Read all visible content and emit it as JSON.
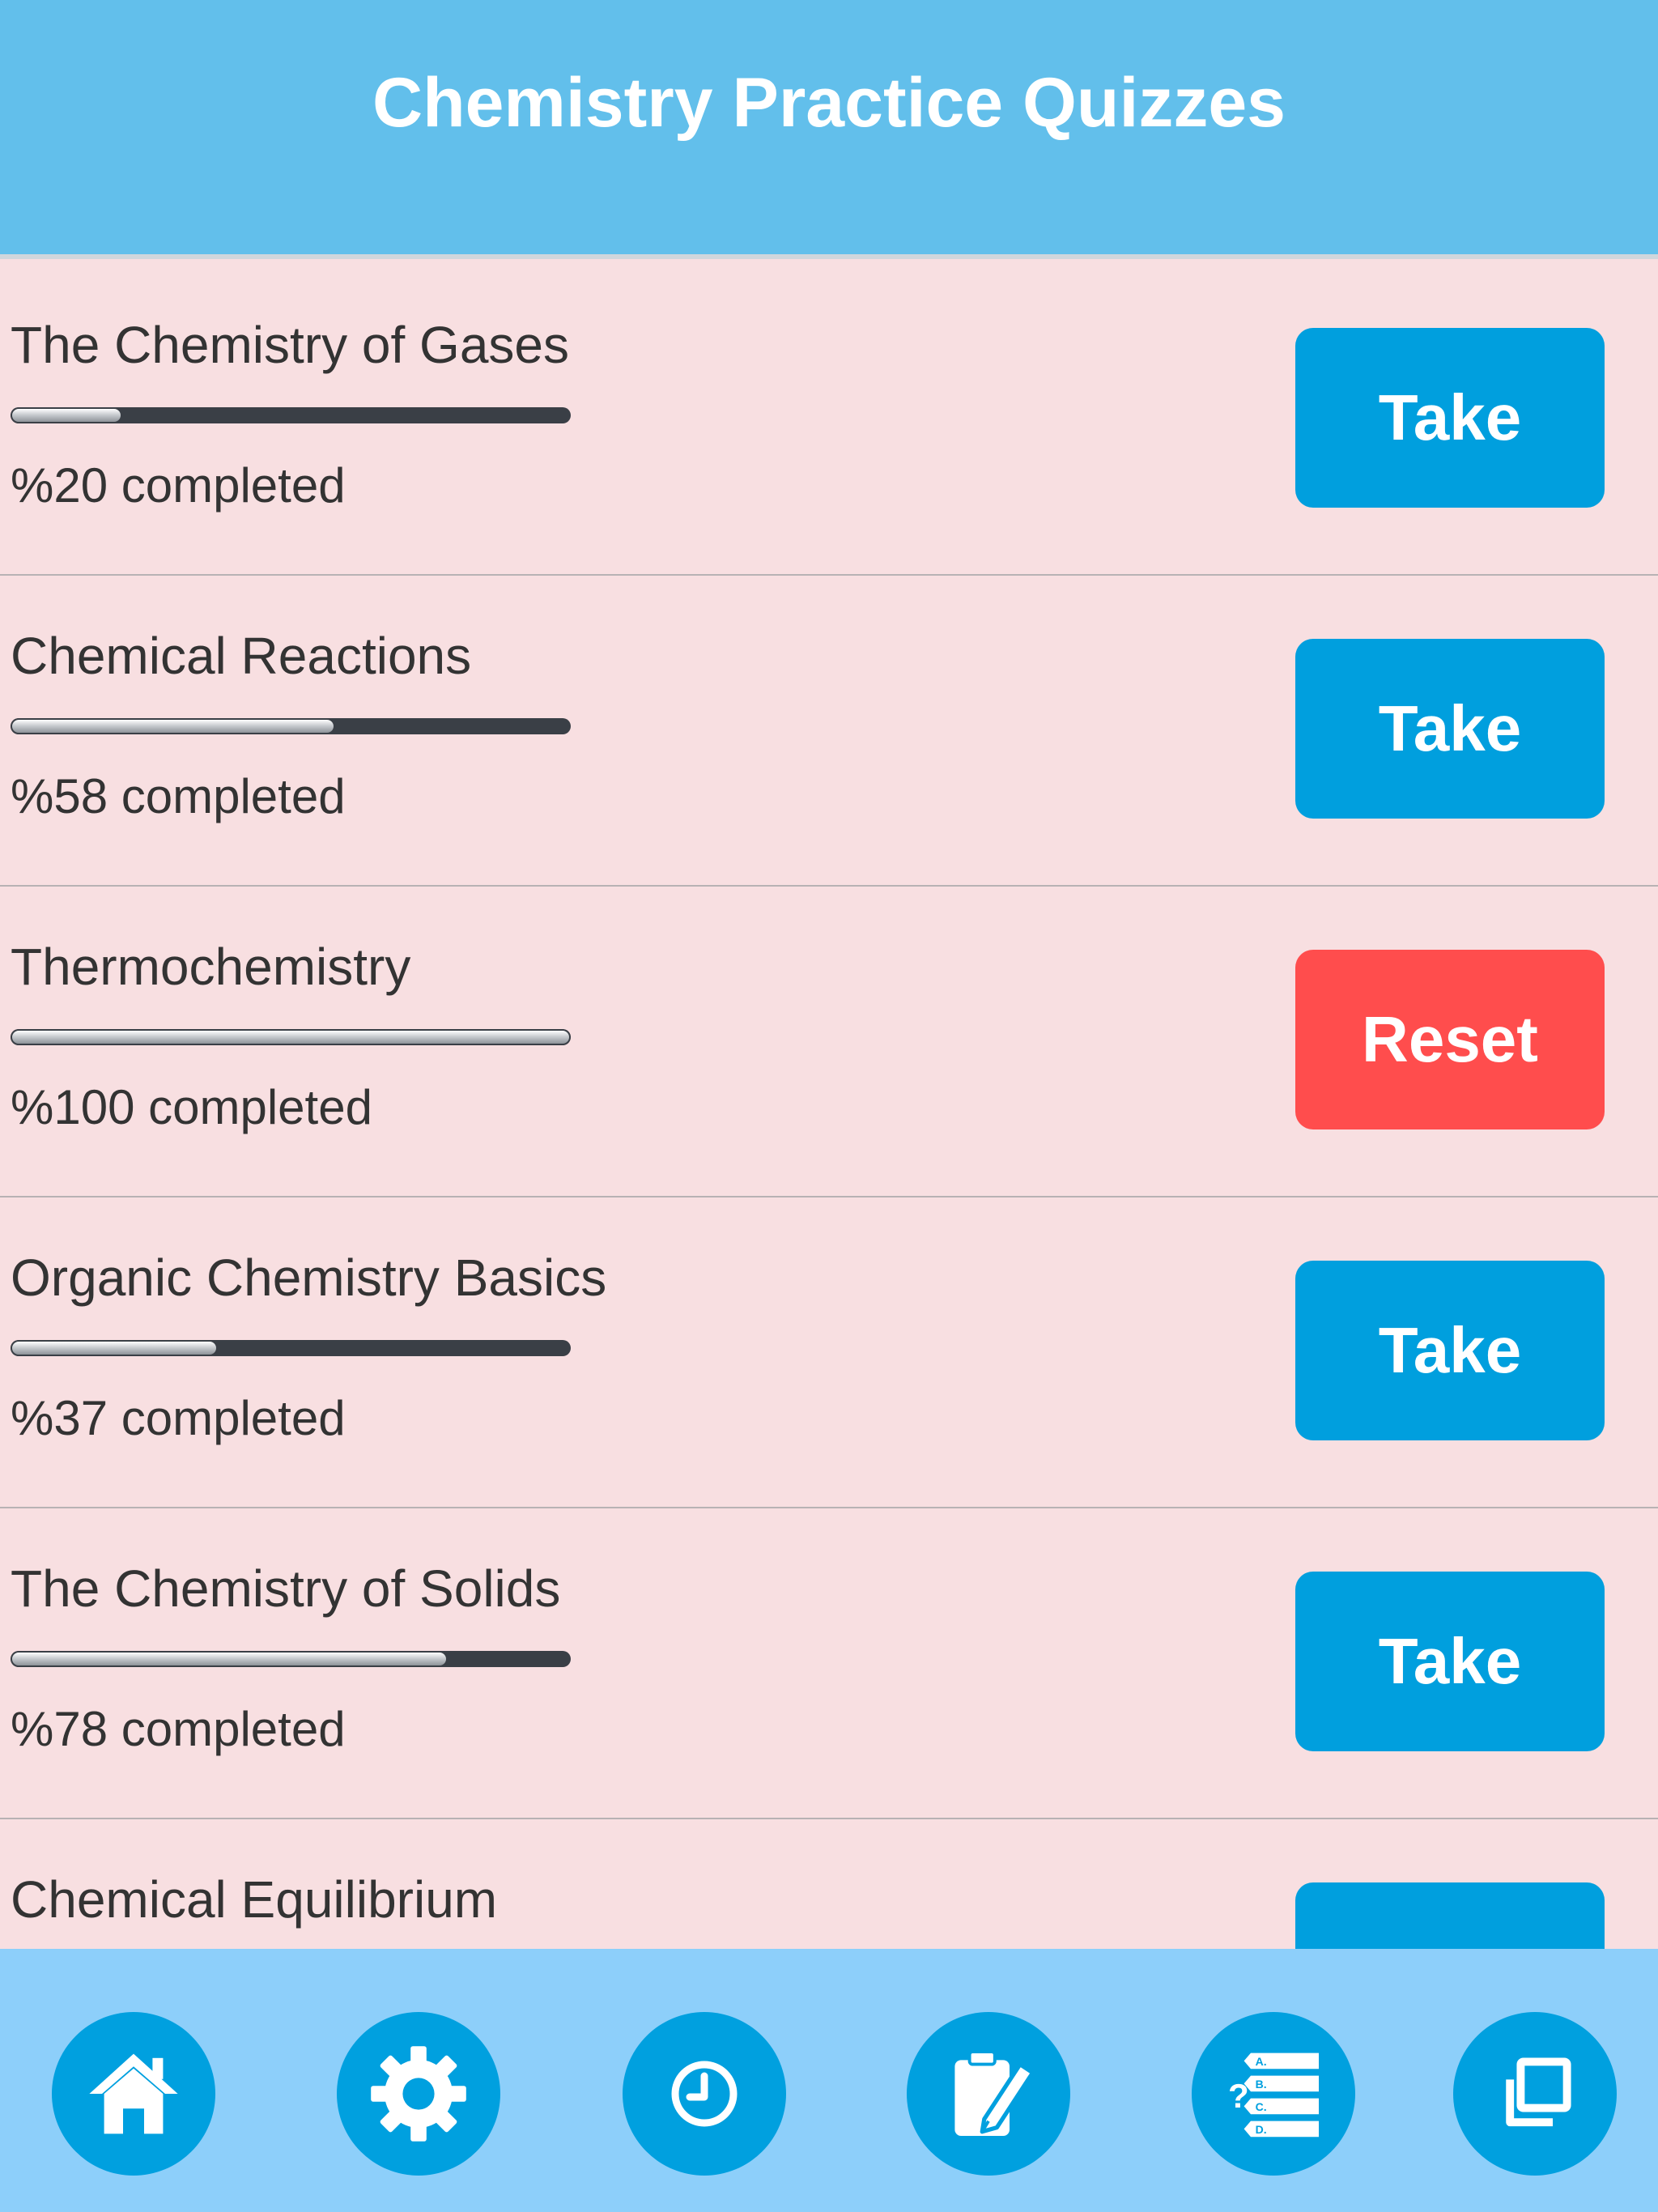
{
  "header": {
    "title": "Chemistry Practice Quizzes"
  },
  "quizzes": [
    {
      "title": "The Chemistry of Gases",
      "progress": 0.2,
      "status": "%20 completed",
      "action": "Take",
      "action_type": "take"
    },
    {
      "title": "Chemical Reactions",
      "progress": 0.58,
      "status": "%58 completed",
      "action": "Take",
      "action_type": "take"
    },
    {
      "title": "Thermochemistry",
      "progress": 1.0,
      "status": "%100 completed",
      "action": "Reset",
      "action_type": "reset"
    },
    {
      "title": "Organic Chemistry Basics",
      "progress": 0.37,
      "status": "%37 completed",
      "action": "Take",
      "action_type": "take"
    },
    {
      "title": "The Chemistry of Solids",
      "progress": 0.78,
      "status": "%78 completed",
      "action": "Take",
      "action_type": "take"
    },
    {
      "title": "Chemical Equilibrium",
      "progress": null,
      "status": "",
      "action": "",
      "action_type": "take"
    }
  ],
  "bottom_nav": {
    "items": [
      {
        "icon": "home-icon"
      },
      {
        "icon": "gear-icon"
      },
      {
        "icon": "clock-icon"
      },
      {
        "icon": "edit-clipboard-icon"
      },
      {
        "icon": "quiz-list-icon"
      },
      {
        "icon": "copy-icon"
      }
    ]
  },
  "colors": {
    "header_bg": "#62bfeb",
    "list_bg": "#f8dfe1",
    "take_button": "#009fde",
    "reset_button": "#ff4d4d",
    "nav_bg": "#8dcffa",
    "nav_button": "#00a0df"
  }
}
